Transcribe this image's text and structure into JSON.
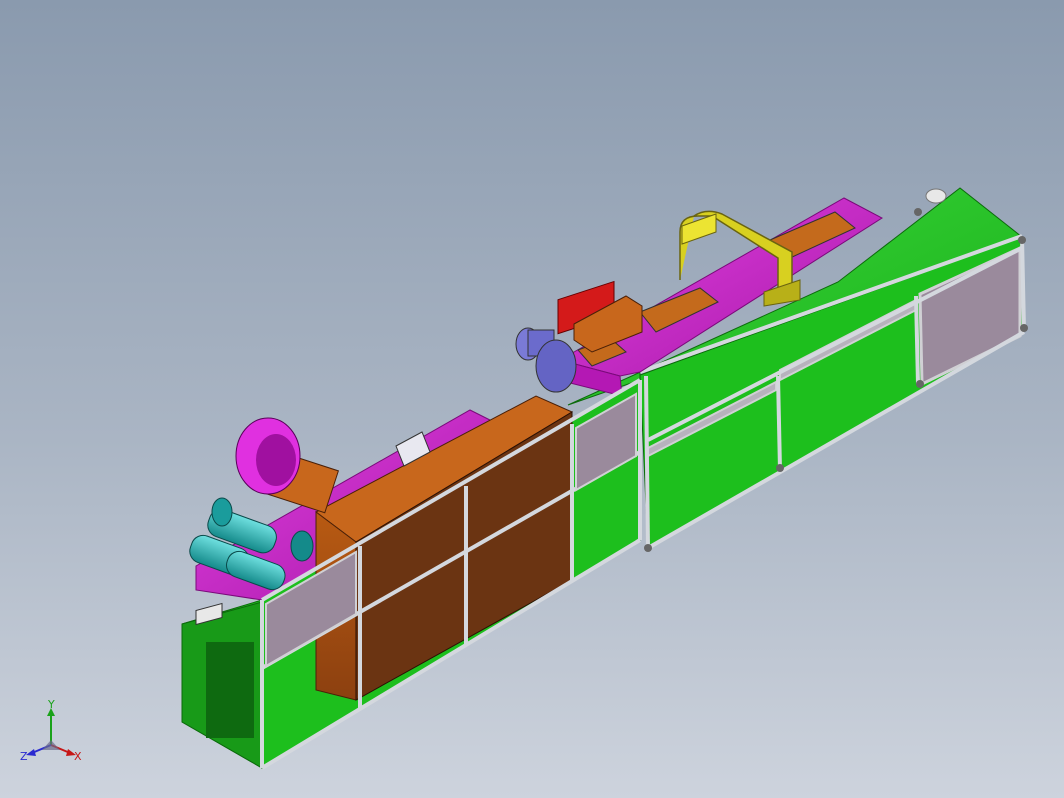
{
  "triad": {
    "x_label": "X",
    "y_label": "Y",
    "z_label": "Z"
  },
  "colors": {
    "background_top": "#8a9aae",
    "background_bottom": "#cdd3dd",
    "frame_green": "#1fc21f",
    "frame_green_dark": "#15941a",
    "magenta": "#cc22cc",
    "orange": "#c8671c",
    "brown_panel": "#6b3412",
    "cyan": "#22b8b8",
    "blue_fan": "#6f6fd0",
    "yellow_duct": "#d8d020",
    "red_box": "#d41a1a",
    "glass": "#9a8c9c",
    "aluminium": "#c8ccd2"
  }
}
